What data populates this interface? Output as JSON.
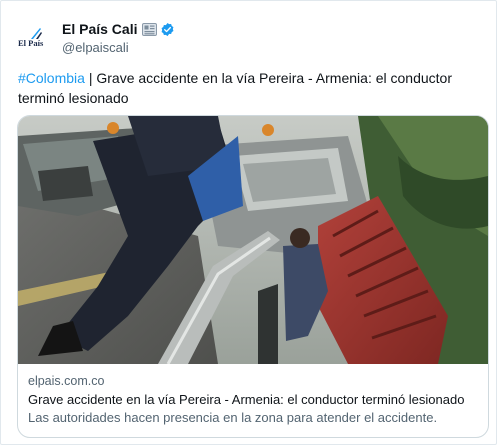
{
  "account": {
    "display_name": "El País Cali",
    "handle": "@elpaiscali",
    "avatar_logo_text": "El País",
    "badges": [
      "newspaper-icon",
      "verified-icon"
    ],
    "verified_color": "#1d9bf0"
  },
  "tweet": {
    "hashtag": "#Colombia",
    "separator": " | ",
    "text": "Grave accidente en la vía Pereira - Armenia: el conductor terminó lesionado",
    "hashtag_color": "#1d9bf0"
  },
  "card": {
    "image_alt": "Tractocamión accidentado sobre la baranda de la vía con personas atendiendo al conductor",
    "domain": "elpais.com.co",
    "title": "Grave accidente en la vía Pereira - Armenia: el conductor terminó lesionado",
    "description": "Las autoridades hacen presencia en la zona para atender el accidente."
  }
}
